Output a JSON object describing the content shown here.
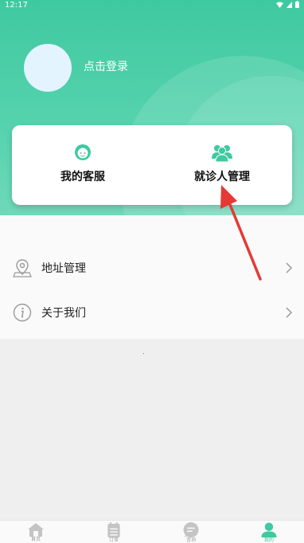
{
  "status_bar": {
    "time": "12:17"
  },
  "profile": {
    "login_text": "点击登录"
  },
  "quick_actions": [
    {
      "label": "我的客服",
      "icon": "customer-service-icon"
    },
    {
      "label": "就诊人管理",
      "icon": "patients-icon"
    }
  ],
  "menu": [
    {
      "label": "地址管理",
      "icon": "location-pin-icon"
    },
    {
      "label": "关于我们",
      "icon": "info-icon"
    }
  ],
  "tabbar": [
    {
      "label": "首页",
      "icon": "home-icon"
    },
    {
      "label": "订单",
      "icon": "orders-icon"
    },
    {
      "label": "咨询",
      "icon": "chat-icon"
    },
    {
      "label": "我的",
      "icon": "person-icon"
    }
  ],
  "colors": {
    "accent": "#3fc9a0",
    "annotation_arrow": "#e53935"
  }
}
